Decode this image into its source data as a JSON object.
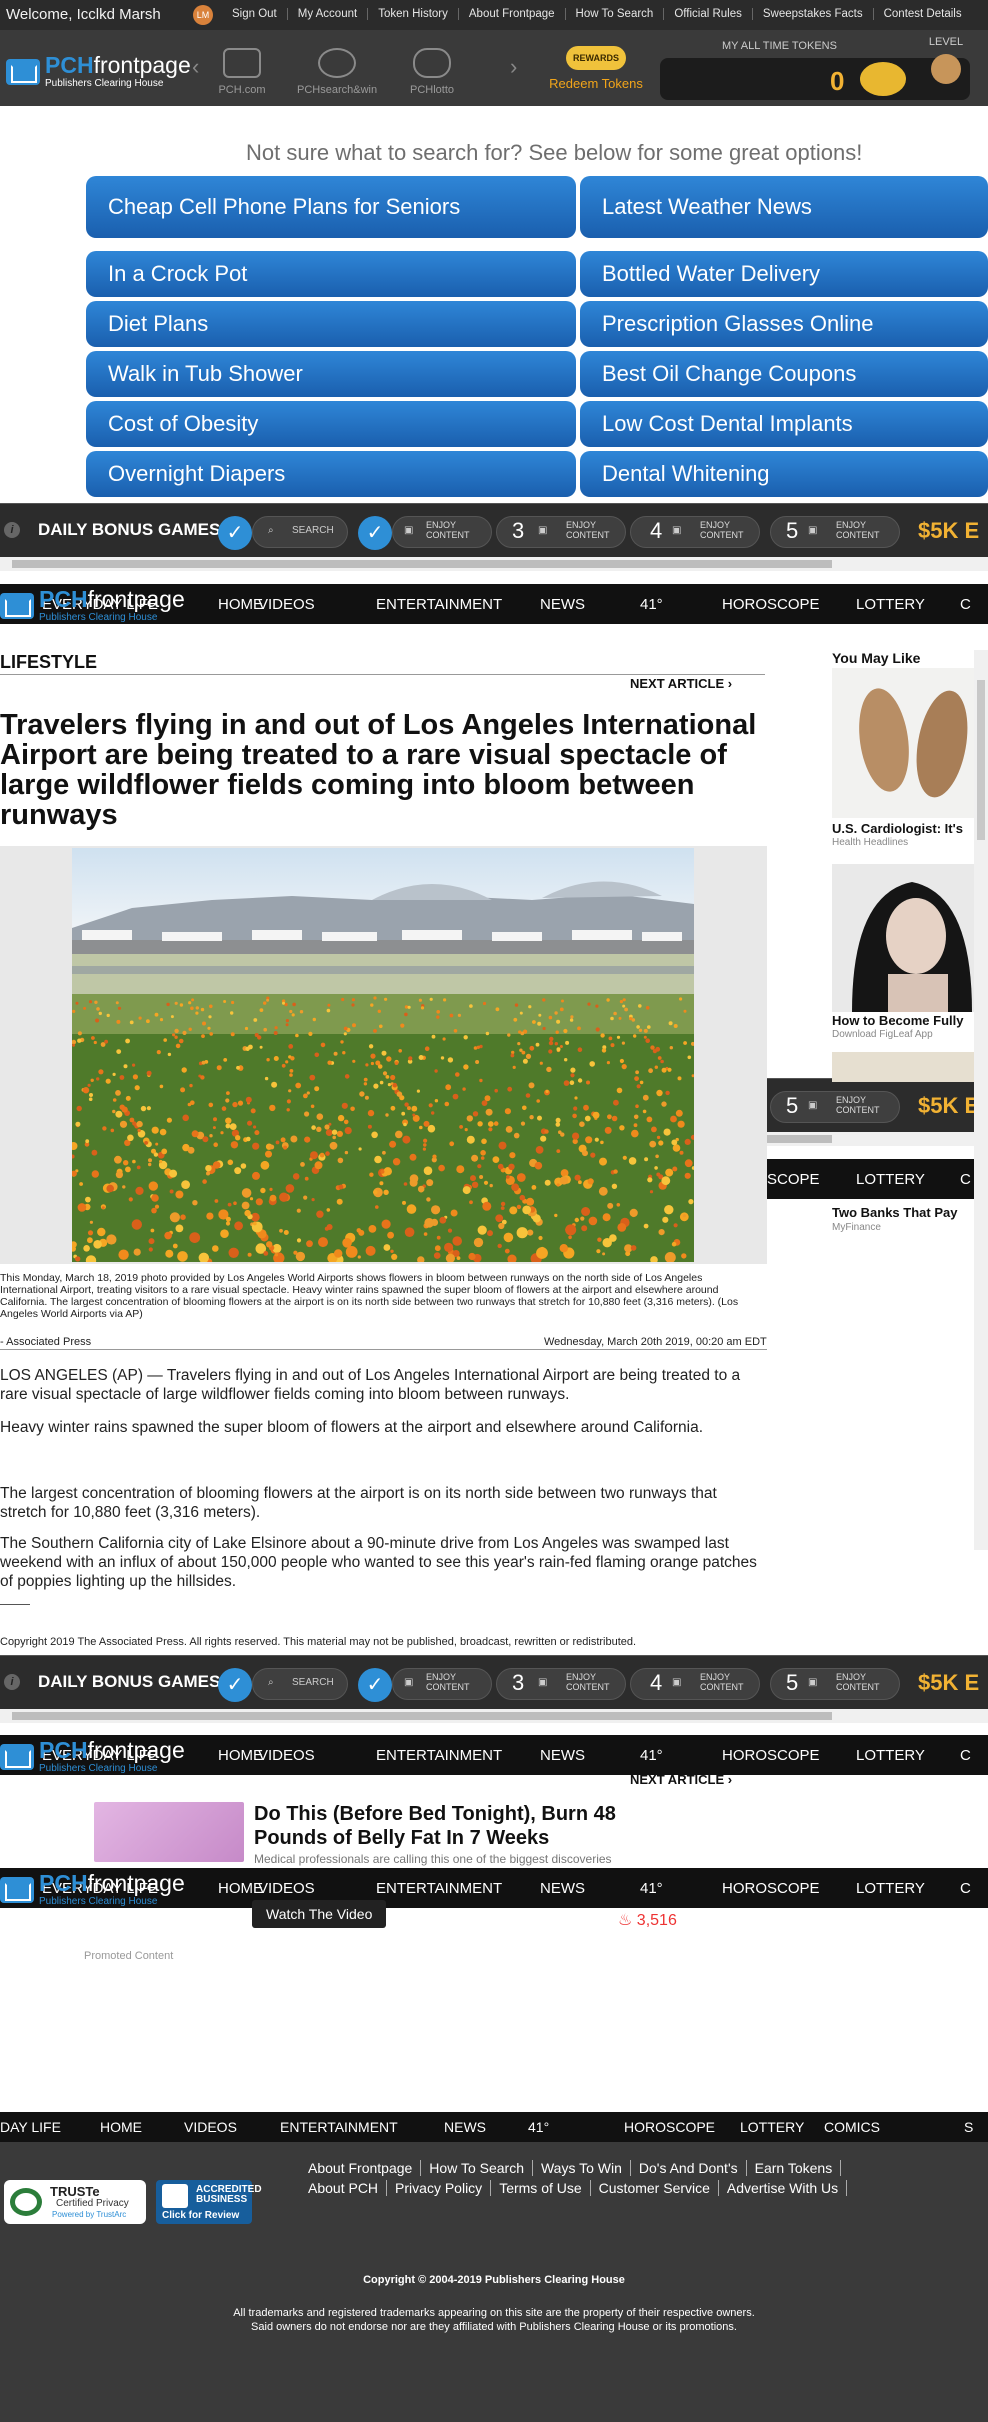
{
  "topbar": {
    "welcome": "Welcome, Icclkd Marsh",
    "avatar_initials": "LM",
    "links": [
      "Sign Out",
      "My Account",
      "Token History",
      "About Frontpage",
      "How To Search",
      "Official Rules",
      "Sweepstakes Facts",
      "Contest Details"
    ]
  },
  "brand": {
    "logo_pch": "PCH",
    "logo_frontpage": "frontpage",
    "logo_sub": "Publishers Clearing House",
    "nav": [
      "PCH.com",
      "PCHsearch&win",
      "PCHlotto"
    ],
    "rewards_badge": "REWARDS",
    "redeem": "Redeem Tokens",
    "tokens_label": "MY ALL TIME TOKENS",
    "tokens_value": "0",
    "level_label": "LEVEL"
  },
  "suggest": {
    "heading": "Not sure what to search for? See below for some great options!",
    "left": [
      "Cheap Cell Phone Plans for Seniors",
      "In a Crock Pot",
      "Diet Plans",
      "Walk in Tub Shower",
      "Cost of Obesity",
      "Overnight Diapers"
    ],
    "right": [
      "Latest Weather News",
      "Bottled Water Delivery",
      "Prescription Glasses Online",
      "Best Oil Change Coupons",
      "Low Cost Dental Implants",
      "Dental Whitening"
    ]
  },
  "bonus": {
    "info": "i",
    "title": "DAILY BONUS GAMES",
    "search": "SEARCH",
    "enjoy1": "ENJOY",
    "enjoy2": "CONTENT",
    "n3": "3",
    "n4": "4",
    "n5": "5",
    "prize": "$5K E"
  },
  "catnav": {
    "items": [
      "EVERYDAY LIFE",
      "HOME",
      "VIDEOS",
      "ENTERTAINMENT",
      "NEWS",
      "41°",
      "HOROSCOPE",
      "LOTTERY",
      "C"
    ],
    "footer_items": [
      "DAY LIFE",
      "HOME",
      "VIDEOS",
      "ENTERTAINMENT",
      "NEWS",
      "41°",
      "HOROSCOPE",
      "LOTTERY",
      "COMICS",
      "S"
    ]
  },
  "article": {
    "section": "LIFESTYLE",
    "next": "NEXT ARTICLE ›",
    "headline": "Travelers flying in and out of Los Angeles International Airport are being treated to a rare visual spectacle of large wildflower fields coming into bloom between runways",
    "caption": "This Monday, March 18, 2019 photo provided by Los Angeles World Airports shows flowers in bloom between runways on the north side of Los Angeles International Airport, treating visitors to a rare visual spectacle. Heavy winter rains spawned the super bloom of flowers at the airport and elsewhere around California. The largest concentration of blooming flowers at the airport is on its north side between two runways that stretch for 10,880 feet (3,316 meters). (Los Angeles World Airports via AP)",
    "byline": "- Associated Press",
    "date": "Wednesday, March 20th 2019, 00:20 am EDT",
    "paragraphs": [
      "LOS ANGELES (AP) — Travelers flying in and out of Los Angeles International Airport are being treated to a rare visual spectacle of large wildflower fields coming into bloom between runways.",
      "Heavy winter rains spawned the super bloom of flowers at the airport and elsewhere around California.",
      "The largest concentration of blooming flowers at the airport is on its north side between two runways that stretch for 10,880 feet (3,316 meters).",
      "The Southern California city of Lake Elsinore about a 90-minute drive from Los Angeles was swamped last weekend with an influx of about 150,000 people who wanted to see this year's rain-fed flaming orange patches of poppies lighting up the hillsides."
    ],
    "copyright": "Copyright 2019 The Associated Press. All rights reserved. This material may not be published, broadcast, rewritten or redistributed."
  },
  "rail": {
    "heading": "You May Like",
    "items": [
      {
        "title": "U.S. Cardiologist: It's",
        "source": "Health Headlines"
      },
      {
        "title": "How to Become Fully",
        "source": "Download FigLeaf App"
      },
      {
        "title": "Two Banks That Pay",
        "source": "MyFinance"
      }
    ]
  },
  "promo": {
    "next": "NEXT ARTICLE ›",
    "title": "Do This (Before Bed Tonight), Burn 48 Pounds of Belly Fat In 7 Weeks",
    "teaser": "Medical professionals are calling this one of the biggest discoveries",
    "watch": "Watch The Video",
    "count": "3,516",
    "promoted": "Promoted Content"
  },
  "footer": {
    "links_row1": [
      "About Frontpage",
      "How To Search",
      "Ways To Win",
      "Do's And Dont's",
      "Earn Tokens",
      ""
    ],
    "links_row2": [
      "About PCH",
      "Privacy Policy",
      "Terms of Use",
      "Customer Service",
      "Advertise With Us",
      ""
    ],
    "truste_t1": "TRUSTe",
    "truste_t2": "Certified Privacy",
    "truste_t3": "Powered by TrustArc",
    "bbb_t1": "ACCREDITED",
    "bbb_t2": "BUSINESS",
    "bbb_t3": "Click for Review",
    "copyright": "Copyright © 2004-2019 Publishers Clearing House",
    "trademark1": "All trademarks and registered trademarks appearing on this site are the property of their respective owners.",
    "trademark2": "Said owners do not endorse nor are they affiliated with Publishers Clearing House or its promotions."
  }
}
